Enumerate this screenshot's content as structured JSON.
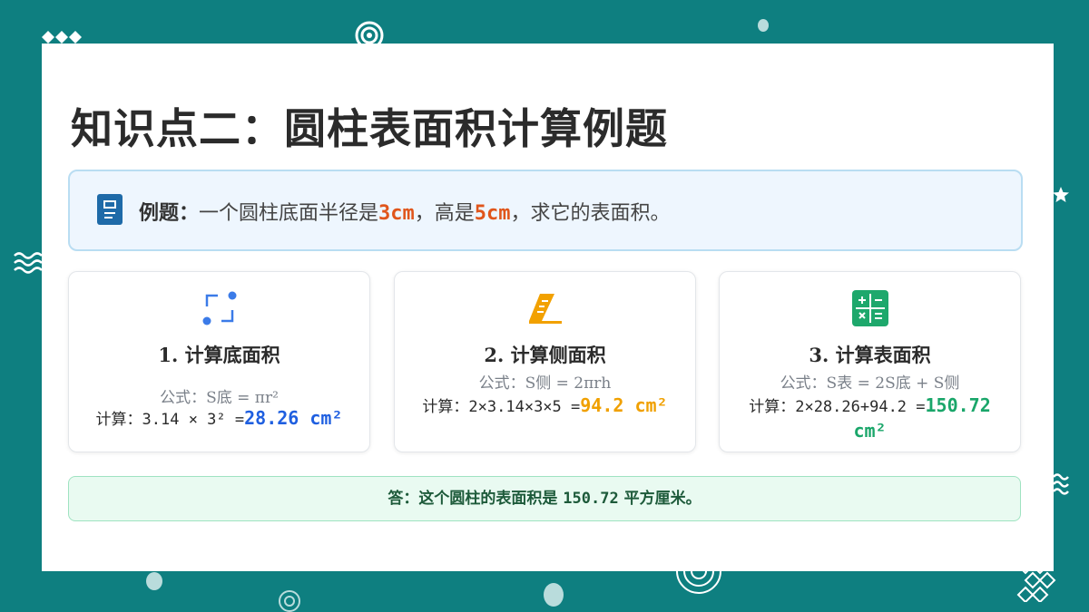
{
  "title": "知识点二：圆柱表面积计算例题",
  "example": {
    "lead": "例题：",
    "text_a": "一个圆柱底面半径是",
    "radius": "3cm",
    "text_b": "，高是",
    "height": "5cm",
    "text_c": "，求它的表面积。"
  },
  "steps": [
    {
      "heading": "1. 计算底面积",
      "formula": "公式：S底 = πr²",
      "calc_prefix": "计算：3.14 × 3² =",
      "result": "28.26 cm²"
    },
    {
      "heading": "2. 计算侧面积",
      "formula": "公式：S侧 = 2πrh",
      "calc_prefix": "计算：2×3.14×3×5 =",
      "result": "94.2 cm²"
    },
    {
      "heading": "3. 计算表面积",
      "formula": "公式：S表 = 2S底 + S侧",
      "calc_prefix": "计算：2×28.26+94.2 =",
      "result": "150.72 cm²"
    }
  ],
  "answer": {
    "prefix": "答：这个圆柱的表面积是",
    "value": "150.72",
    "suffix": "平方厘米。"
  },
  "icons": [
    "document-icon",
    "square-corner-icon",
    "ruler-icon",
    "calculator-icon"
  ],
  "colors": {
    "background": "#0e7f80",
    "highlight_orange": "#e0551b",
    "result_blue": "#1f5fe0",
    "result_orange": "#f0a000",
    "result_green": "#1aa66a"
  }
}
